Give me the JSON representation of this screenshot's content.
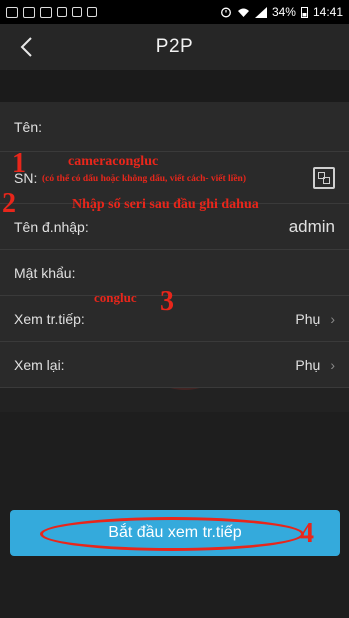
{
  "status_bar": {
    "battery": "34%",
    "time": "14:41"
  },
  "header": {
    "title": "P2P"
  },
  "form": {
    "name_label": "Tên:",
    "sn_label": "SN:",
    "username_label": "Tên đ.nhập:",
    "username_value": "admin",
    "password_label": "Mật khẩu:",
    "live_view_label": "Xem tr.tiếp:",
    "live_view_value": "Phụ",
    "playback_label": "Xem lại:",
    "playback_value": "Phụ"
  },
  "annotations": {
    "num1": "1",
    "name_hint": "cameracongluc",
    "name_note": "(có thể có dấu hoặc không dấu, viết cách- viết liền)",
    "num2": "2",
    "sn_hint": "Nhập số seri sau đầu ghi dahua",
    "password_hint": "congluc",
    "num3": "3",
    "num4": "4"
  },
  "start_button": {
    "label": "Bắt đầu xem tr.tiếp"
  },
  "colors": {
    "accent": "#34aadc",
    "annotation": "#e8261b",
    "background": "#222222"
  }
}
